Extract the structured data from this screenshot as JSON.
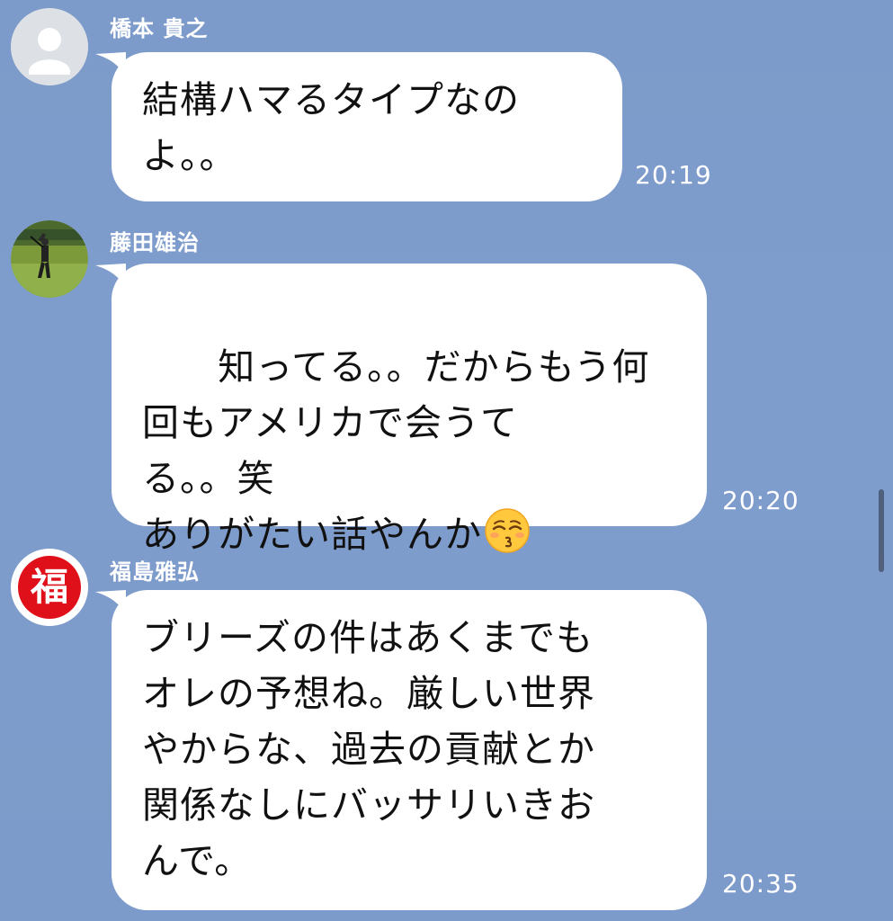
{
  "messages": [
    {
      "sender": "橋本 貴之",
      "text": "結構ハマるタイプなの\nよ。。",
      "time": "20:19",
      "avatar": "default-person-icon"
    },
    {
      "sender": "藤田雄治",
      "text": "知ってる。。だからもう何\n回もアメリカで会うて\nる。。笑\nありがたい話やんか",
      "emoji": "kissing-face-with-closed-eyes",
      "time": "20:20",
      "avatar": "golfer-photo"
    },
    {
      "sender": "福島雅弘",
      "text": "ブリーズの件はあくまでも\nオレの予想ね。厳しい世界\nやからな、過去の貢献とか\n関係なしにバッサリいきお\nんで。",
      "time": "20:35",
      "avatar": "fuku-badge",
      "avatar_glyph": "福"
    }
  ],
  "colors": {
    "background": "#7f9ccb",
    "bubble": "#ffffff",
    "text": "#111111",
    "accent_red": "#e0101a"
  }
}
